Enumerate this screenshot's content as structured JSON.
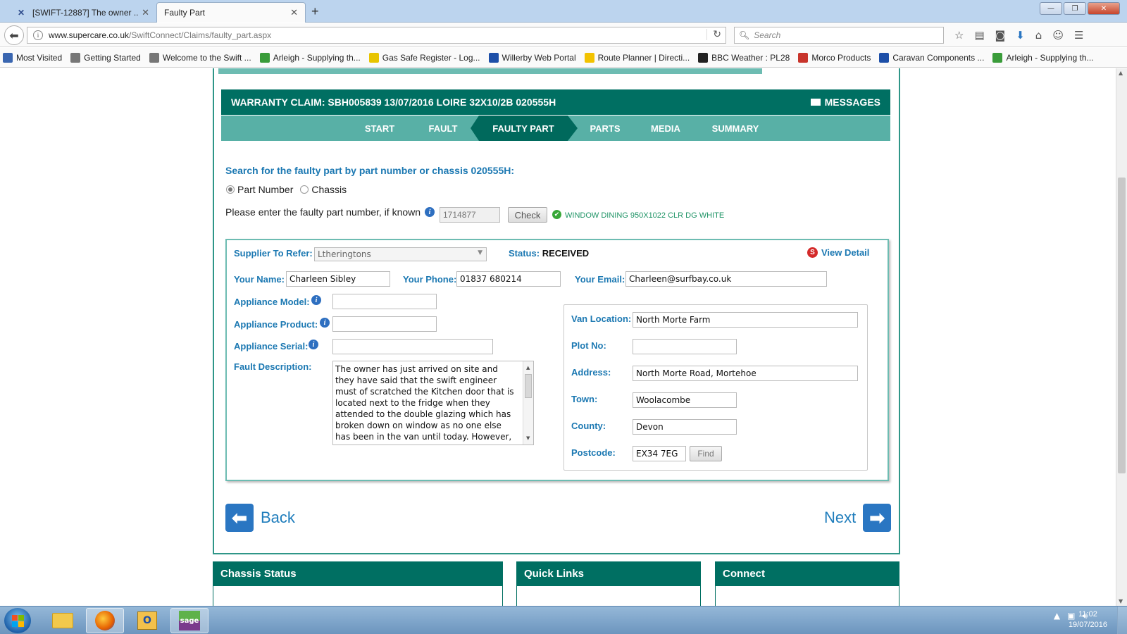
{
  "browser": {
    "tabs": [
      {
        "label": "[SWIFT-12887] The owner ...",
        "icon": "jira-icon"
      },
      {
        "label": "Faulty Part",
        "icon": "none"
      }
    ],
    "url_domain": "www.supercare.co.uk",
    "url_path": "/SwiftConnect/Claims/faulty_part.aspx",
    "search_placeholder": "Search",
    "bookmarks": [
      {
        "label": "Most Visited",
        "color": "#3a66b0"
      },
      {
        "label": "Getting Started",
        "color": "#777777"
      },
      {
        "label": "Welcome to the Swift ...",
        "color": "#777777"
      },
      {
        "label": "Arleigh - Supplying th...",
        "color": "#3a9c3a"
      },
      {
        "label": "Gas Safe Register - Log...",
        "color": "#e8c400"
      },
      {
        "label": "Willerby Web Portal",
        "color": "#1d4fa8"
      },
      {
        "label": "Route Planner | Directi...",
        "color": "#f2c200"
      },
      {
        "label": "BBC Weather : PL28",
        "color": "#222222"
      },
      {
        "label": "Morco Products",
        "color": "#c8342b"
      },
      {
        "label": "Caravan Components ...",
        "color": "#1d4fa8"
      },
      {
        "label": "Arleigh - Supplying th...",
        "color": "#3a9c3a"
      }
    ]
  },
  "claim": {
    "title": "WARRANTY CLAIM: SBH005839 13/07/2016 LOIRE 32X10/2B 020555H",
    "messages_label": "MESSAGES",
    "steps": [
      "START",
      "FAULT",
      "FAULTY PART",
      "PARTS",
      "MEDIA",
      "SUMMARY"
    ],
    "active_step": "FAULTY PART"
  },
  "search": {
    "title": "Search for the faulty part by part number or chassis 020555H:",
    "radio_part_number": "Part Number",
    "radio_chassis": "Chassis",
    "selected": "Part Number",
    "part_prompt": "Please enter the faulty part number, if known",
    "part_number": "1714877",
    "check_label": "Check",
    "part_description": "WINDOW DINING 950X1022 CLR DG WHITE"
  },
  "details": {
    "supplier_label": "Supplier To Refer:",
    "supplier_value": "Ltherington​s",
    "status_label": "Status:",
    "status_value": "RECEIVED",
    "view_detail": "View Detail",
    "name_label": "Your Name:",
    "name_value": "Charleen Sibley",
    "phone_label": "Your Phone:",
    "phone_value": "01837 680214",
    "email_label": "Your Email:",
    "email_value": "Charleen@surfbay.co.uk",
    "appliance_model_label": "Appliance Model:",
    "appliance_model_value": "",
    "appliance_product_label": "Appliance Product:",
    "appliance_product_value": "",
    "appliance_serial_label": "Appliance Serial:",
    "appliance_serial_value": "",
    "fault_label": "Fault Description:",
    "fault_value": "The owner has just arrived on site and they have said that the swift engineer must of scratched the Kitchen door that is located next to the fridge when they attended to the double glazing which has broken down on window as no one else has been in the van until today.  However, connect says"
  },
  "van": {
    "location_label": "Van Location:",
    "location_value": "North Morte Farm",
    "plot_label": "Plot No:",
    "plot_value": "",
    "address_label": "Address:",
    "address_value": "North Morte Road, Mortehoe",
    "town_label": "Town:",
    "town_value": "Woolacombe",
    "county_label": "County:",
    "county_value": "Devon",
    "postcode_label": "Postcode:",
    "postcode_value": "EX34 7EG",
    "find_label": "Find"
  },
  "nav": {
    "back_label": "Back",
    "next_label": "Next"
  },
  "bottom_panels": [
    "Chassis Status",
    "Quick Links",
    "Connect"
  ],
  "taskbar": {
    "time": "11:02",
    "date": "19/07/2016"
  },
  "colors": {
    "header_teal": "#006f62",
    "step_teal": "#58b0a6",
    "label_blue": "#1b78b2"
  }
}
